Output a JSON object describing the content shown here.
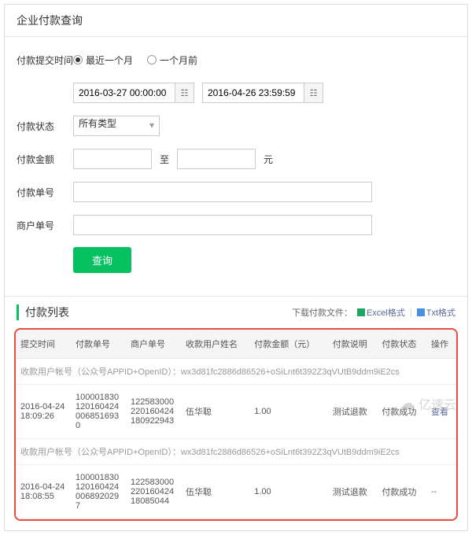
{
  "header": {
    "title": "企业付款查询"
  },
  "form": {
    "labels": {
      "submitTime": "付款提交时间",
      "status": "付款状态",
      "amount": "付款金额",
      "orderNo": "付款单号",
      "merchantNo": "商户单号"
    },
    "radios": {
      "recentMonth": "最近一个月",
      "monthAgo": "一个月前"
    },
    "dateFrom": "2016-03-27 00:00:00",
    "dateTo": "2016-04-26 23:59:59",
    "statusSelect": "所有类型",
    "amountSep": "至",
    "amountUnit": "元",
    "queryBtn": "查询"
  },
  "list": {
    "title": "付款列表",
    "downloadLabel": "下载付款文件：",
    "excelLabel": "Excel格式",
    "txtLabel": "Txt格式",
    "columns": {
      "time": "提交时间",
      "orderNo": "付款单号",
      "merchantNo": "商户单号",
      "recvName": "收款用户姓名",
      "amount": "付款金额（元）",
      "desc": "付款说明",
      "status": "付款状态",
      "action": "操作"
    },
    "rows": [
      {
        "acct": "收款用户帐号（公众号APPID+OpenID）：wx3d81fc2886d86526+oSiLnt6t392Z3qVUtB9ddm9iE2cs",
        "time": "2016-04-24 18:09:26",
        "orderNo": "10000183012016042400685169​30",
        "merchantNo": "12258300022016042418092294​3",
        "recvName": "伍华聪",
        "amount": "1.00",
        "desc": "测试退款",
        "status": "付款成功",
        "action": "查看"
      },
      {
        "acct": "收款用户帐号（公众号APPID+OpenID）：wx3d81fc2886d86526+oSiLnt6t392Z3qVUtB9ddm9iE2cs",
        "time": "2016-04-24 18:08:55",
        "orderNo": "10000183012016042400689202​97",
        "merchantNo": "12258300022016042418085044",
        "recvName": "伍华聪",
        "amount": "1.00",
        "desc": "测试退款",
        "status": "付款成功",
        "action": "--"
      }
    ]
  },
  "watermark": "亿速云"
}
